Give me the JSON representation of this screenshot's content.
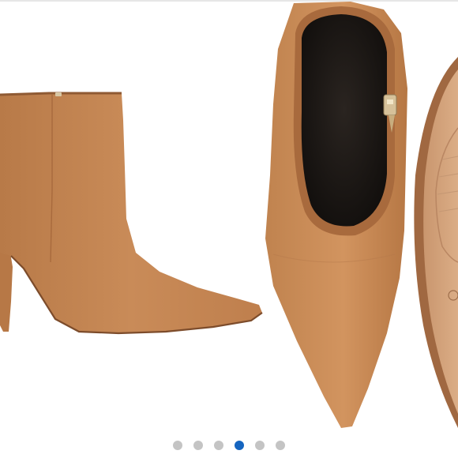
{
  "carousel": {
    "slide_count": 6,
    "active_index": 3
  },
  "colors": {
    "suede": "#c48552",
    "suede_dark": "#a86a3d",
    "lining": "#1e1a18",
    "dot_inactive": "#c4c4c4",
    "dot_active": "#1565c0"
  },
  "icons": {
    "zipper": "zipper-pull-icon"
  }
}
